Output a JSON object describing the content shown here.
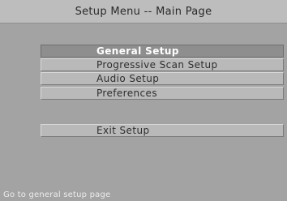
{
  "title": "Setup Menu -- Main Page",
  "menu": {
    "items": [
      {
        "label": "General Setup",
        "selected": true
      },
      {
        "label": "Progressive Scan Setup",
        "selected": false
      },
      {
        "label": "Audio Setup",
        "selected": false
      },
      {
        "label": "Preferences",
        "selected": false
      }
    ],
    "exit_label": "Exit Setup"
  },
  "status": "Go to general setup page",
  "colors": {
    "background": "#a3a3a3",
    "highlight": "#8e8e8e",
    "item": "#b9b9b9"
  }
}
